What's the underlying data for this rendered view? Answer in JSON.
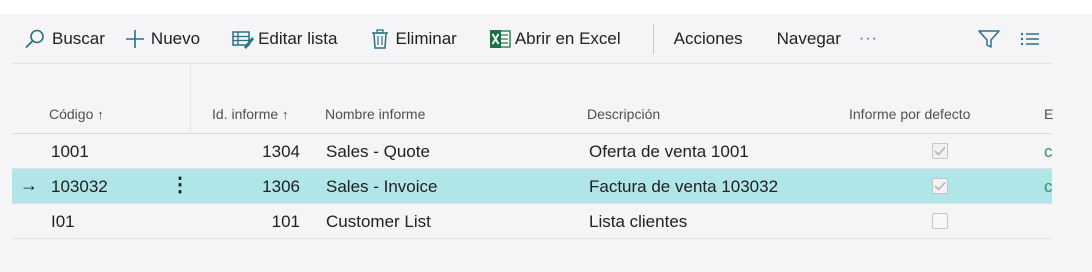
{
  "toolbar": {
    "buscar": "Buscar",
    "nuevo": "Nuevo",
    "editar_lista": "Editar lista",
    "eliminar": "Eliminar",
    "abrir_excel": "Abrir en Excel",
    "acciones": "Acciones",
    "navegar": "Navegar",
    "more": "···"
  },
  "columns": {
    "codigo": "Código",
    "id_informe": "Id. informe",
    "nombre_informe": "Nombre informe",
    "descripcion": "Descripción",
    "informe_por_defecto": "Informe por defecto",
    "extra": "E"
  },
  "rows": [
    {
      "codigo": "1001",
      "id_informe": "1304",
      "nombre_informe": "Sales - Quote",
      "descripcion": "Oferta de venta 1001",
      "por_defecto": true,
      "extra": "c"
    },
    {
      "codigo": "103032",
      "id_informe": "1306",
      "nombre_informe": "Sales - Invoice",
      "descripcion": "Factura de venta 103032",
      "por_defecto": true,
      "extra": "c"
    },
    {
      "codigo": "I01",
      "id_informe": "101",
      "nombre_informe": "Customer List",
      "descripcion": "Lista clientes",
      "por_defecto": false,
      "extra": ""
    }
  ],
  "selected_row": 1,
  "icons": {
    "search": "search-icon",
    "new": "plus-icon",
    "edit_list": "edit-list-icon",
    "delete": "trash-icon",
    "excel": "excel-icon",
    "filter": "filter-icon",
    "list_view": "list-view-icon",
    "row_arrow": "arrow-right-icon",
    "row_menu": "kebab-menu-icon",
    "sort": "sort-ascending-icon"
  },
  "colors": {
    "accent": "#2b6f84",
    "excel_green": "#1e7145",
    "selected_row": "#b1e6e9",
    "link": "#2f8f6f"
  }
}
